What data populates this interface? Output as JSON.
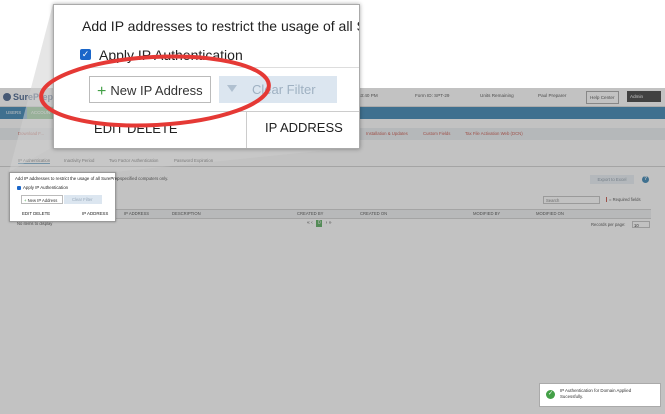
{
  "app": {
    "logo_text": "SurePrep",
    "date_text": "Nov 30, 2021 04:53:40 PM",
    "form_id": "Form ID: SPT-29",
    "units": "Units Remaining",
    "user": "Paul Preparer",
    "help_center": "Help Center",
    "admin": "Admin"
  },
  "nav": {
    "items": [
      {
        "label": "USERS"
      },
      {
        "label": "ACCOUN"
      }
    ]
  },
  "submenu": {
    "items": [
      {
        "label": "Download F..."
      },
      {
        "label": "Installation & Updates"
      },
      {
        "label": "Custom Fields"
      },
      {
        "label": "Tax File Activation Web (DCN)"
      }
    ]
  },
  "tabs": [
    {
      "label": "IP Authentication"
    },
    {
      "label": "Inactivity Period"
    },
    {
      "label": "Two Factor Authentication"
    },
    {
      "label": "Password Expiration"
    }
  ],
  "main": {
    "description_full": "Add IP addresses to restrict the usage of all SurePrep software and services to specified computers only.",
    "description_zoom": "Add IP addresses to restrict the usage of all Su",
    "apply_label": "Apply IP Authentication",
    "new_ip_label": "New IP Address",
    "clear_filter_label": "Clear Filter",
    "export_label": "Export to Excel",
    "search_placeholder": "Search",
    "required_fields": "= Required fields",
    "edit_delete": "EDIT DELETE",
    "no_items": "No items to display",
    "pager_current": "0",
    "records_per_page_label": "Records per page:",
    "records_per_page_value": "10"
  },
  "grid": {
    "columns": [
      "IP ADDRESS",
      "DESCRIPTION",
      "CREATED BY",
      "CREATED ON",
      "MODIFIED BY",
      "MODIFIED ON"
    ]
  },
  "toast": {
    "message": "IP Authentication for Domain Applied Sucessfully."
  },
  "colors": {
    "accent_blue": "#1e73a8",
    "accent_green": "#43a047",
    "highlight_red": "#e53935"
  }
}
